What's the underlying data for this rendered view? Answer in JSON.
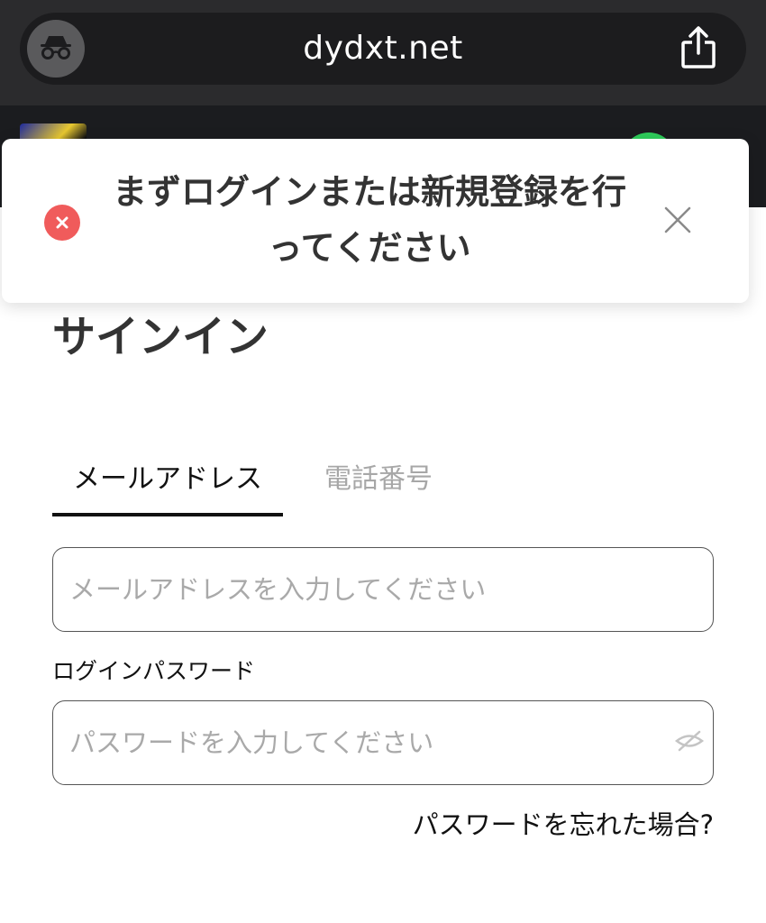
{
  "browser": {
    "url": "dydxt.net",
    "icons": {
      "incognito": "incognito-icon",
      "share": "share-icon"
    }
  },
  "toast": {
    "message": "まずログインまたは新規登録を行ってください",
    "icons": {
      "status": "error-icon",
      "close": "close-icon"
    }
  },
  "signin": {
    "title": "サインイン",
    "tabs": [
      {
        "label": "メールアドレス",
        "active": true
      },
      {
        "label": "電話番号",
        "active": false
      }
    ],
    "email": {
      "value": "",
      "placeholder": "メールアドレスを入力してください"
    },
    "password": {
      "label": "ログインパスワード",
      "value": "",
      "placeholder": "パスワードを入力してください",
      "toggle_icon": "eye-off-icon"
    },
    "forgot_link": "パスワードを忘れた場合?"
  },
  "colors": {
    "browser_bar": "#2b2b2d",
    "site_header": "#1b1c1f",
    "error": "#f05b5b",
    "text_primary": "#333333",
    "tab_inactive": "#a7a7a7"
  }
}
